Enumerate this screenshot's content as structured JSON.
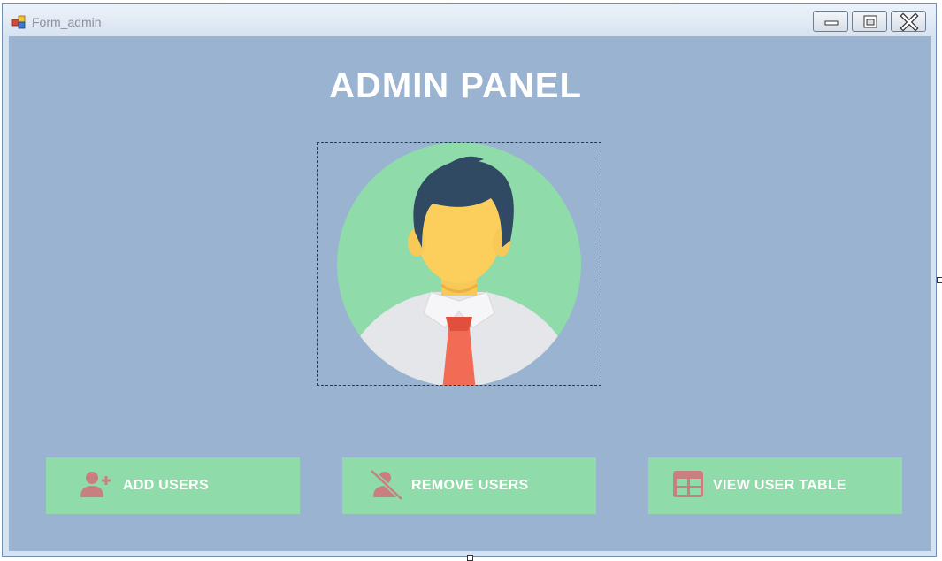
{
  "window": {
    "title": "Form_admin",
    "icon": "winforms-app-icon",
    "controls": [
      "minimize-icon",
      "maximize-icon",
      "close-icon"
    ]
  },
  "main": {
    "heading": "ADMIN PANEL",
    "avatar": "admin-avatar-illustration"
  },
  "buttons": [
    {
      "label": "ADD USERS",
      "icon": "add-user-icon"
    },
    {
      "label": "REMOVE USERS",
      "icon": "remove-user-icon"
    },
    {
      "label": "VIEW USER TABLE",
      "icon": "table-icon"
    }
  ],
  "colors": {
    "background": "#99b3d1",
    "button": "#8fdba9",
    "icon": "#c97f7f",
    "heading": "#ffffff"
  }
}
